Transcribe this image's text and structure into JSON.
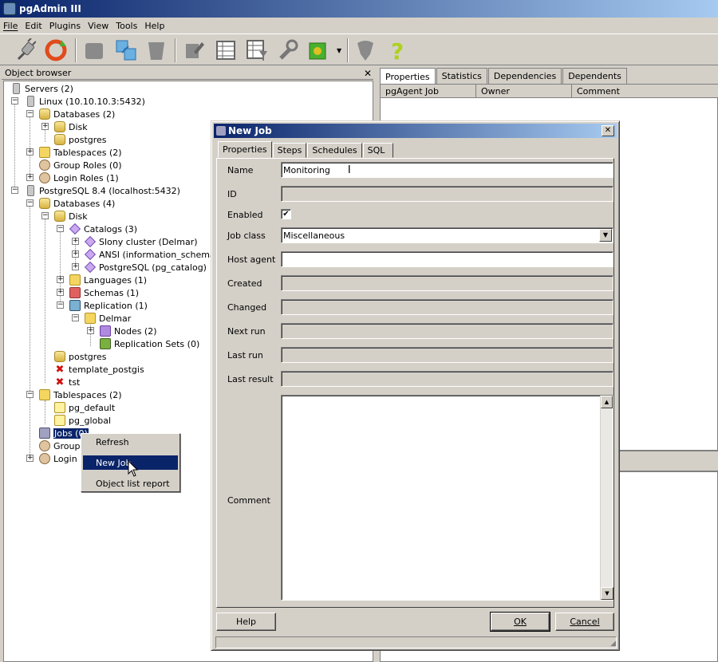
{
  "app": {
    "title": "pgAdmin III"
  },
  "menu": [
    "File",
    "Edit",
    "Plugins",
    "View",
    "Tools",
    "Help"
  ],
  "toolbar": {
    "icons": [
      "connect-icon",
      "refresh-icon",
      "properties-icon",
      "create-icon",
      "drop-icon",
      "sql-icon",
      "view-data-icon",
      "filtered-data-icon",
      "maintenance-icon",
      "plugins-icon",
      "hint-icon",
      "help-icon"
    ]
  },
  "object_browser": {
    "title": "Object browser",
    "nodes": [
      "Servers (2)",
      "Linux (10.10.10.3:5432)",
      "Databases (2)",
      "Disk",
      "postgres",
      "Tablespaces (2)",
      "Group Roles (0)",
      "Login Roles (1)",
      "PostgreSQL 8.4 (localhost:5432)",
      "Databases (4)",
      "Disk",
      "Catalogs (3)",
      "Slony cluster (Delmar)",
      "ANSI (information_schema)",
      "PostgreSQL (pg_catalog)",
      "Languages (1)",
      "Schemas (1)",
      "Replication (1)",
      "Delmar",
      "Nodes (2)",
      "Replication Sets (0)",
      "postgres",
      "template_postgis",
      "tst",
      "Tablespaces (2)",
      "pg_default",
      "pg_global",
      "Jobs (0)",
      "Group R",
      "Login R"
    ]
  },
  "right_panel": {
    "tabs": [
      "Properties",
      "Statistics",
      "Dependencies",
      "Dependents"
    ],
    "columns": [
      "pgAgent Job",
      "Owner",
      "Comment"
    ]
  },
  "context_menu": {
    "items": [
      "Refresh",
      "New Job",
      "Object list report"
    ]
  },
  "dialog": {
    "title": "New Job",
    "tabs": [
      "Properties",
      "Steps",
      "Schedules",
      "SQL"
    ],
    "labels": {
      "name": "Name",
      "id": "ID",
      "enabled": "Enabled",
      "job_class": "Job class",
      "host_agent": "Host agent",
      "created": "Created",
      "changed": "Changed",
      "next_run": "Next run",
      "last_run": "Last run",
      "last_result": "Last result",
      "comment": "Comment"
    },
    "values": {
      "name": "Monitoring",
      "job_class": "Miscellaneous",
      "enabled": true
    },
    "buttons": {
      "help": "Help",
      "ok": "OK",
      "cancel": "Cancel"
    }
  }
}
